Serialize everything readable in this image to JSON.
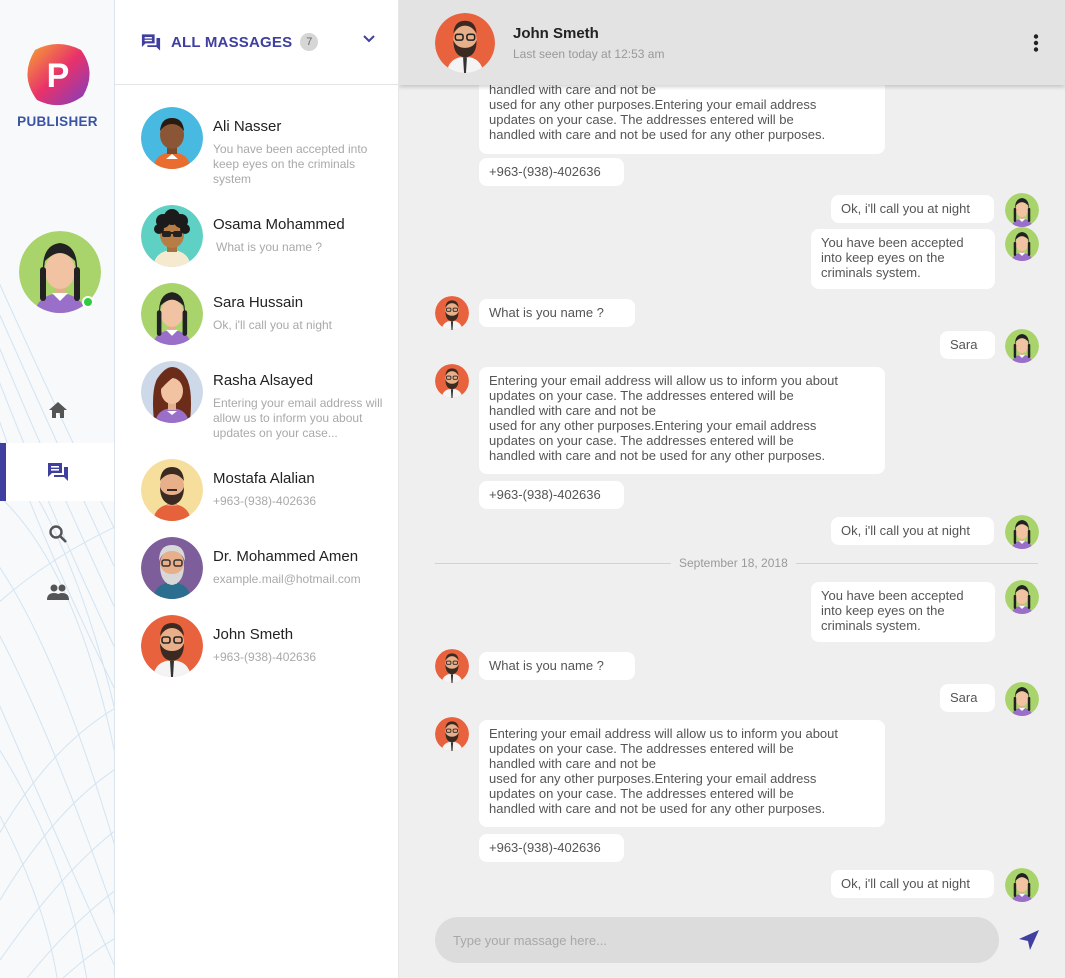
{
  "app": {
    "brand": "PUBLISHER",
    "logo_letter": "P"
  },
  "sidebar": {
    "items": [
      {
        "name": "home",
        "icon": "home-icon"
      },
      {
        "name": "messages",
        "icon": "chat-icon",
        "active": true
      },
      {
        "name": "search",
        "icon": "search-icon"
      },
      {
        "name": "contacts",
        "icon": "people-icon"
      }
    ]
  },
  "contacts_panel": {
    "title": "ALL MASSAGES",
    "count": "7",
    "contacts": [
      {
        "name": "Ali Nasser",
        "preview": "You have been accepted into keep eyes on the criminals system"
      },
      {
        "name": "Osama Mohammed",
        "preview": "What is you name ?"
      },
      {
        "name": "Sara Hussain",
        "preview": "Ok, i'll call you at night"
      },
      {
        "name": "Rasha Alsayed",
        "preview": "Entering your email address will allow us to inform you about updates on your case..."
      },
      {
        "name": "Mostafa Alalian",
        "preview": "+963-(938)-402636"
      },
      {
        "name": "Dr. Mohammed Amen",
        "preview": "example.mail@hotmail.com"
      },
      {
        "name": "John Smeth",
        "preview": "+963-(938)-402636"
      }
    ]
  },
  "chat": {
    "contact_name": "John Smeth",
    "last_seen": "Last seen today at 12:53 am",
    "date_divider": "September 18, 2018",
    "input_placeholder": "Type your massage here...",
    "messages": [
      {
        "from": "them",
        "text": "handled with care and not be\nused for any other purposes.Entering your email address\nupdates on your case. The addresses entered will be\nhandled with care and not be used for any other purposes."
      },
      {
        "from": "them",
        "text": "+963-(938)-402636"
      },
      {
        "from": "me",
        "text": "Ok, i'll call you at night"
      },
      {
        "from": "me",
        "text": "You have been accepted\ninto keep eyes on the\ncriminals system."
      },
      {
        "from": "them",
        "text": "What is you name ?"
      },
      {
        "from": "me",
        "text": "Sara"
      },
      {
        "from": "them",
        "text": "Entering your email address will allow us to inform you about\nupdates on your case. The addresses entered will be\nhandled with care and not be\nused for any other purposes.Entering your email address\nupdates on your case. The addresses entered will be\nhandled with care and not be used for any other purposes."
      },
      {
        "from": "them",
        "text": "+963-(938)-402636"
      },
      {
        "from": "me",
        "text": "Ok, i'll call you at night"
      },
      {
        "from": "me",
        "text": "You have been accepted\ninto keep eyes on the\ncriminals system."
      },
      {
        "from": "them",
        "text": "What is you name ?"
      },
      {
        "from": "me",
        "text": "Sara"
      },
      {
        "from": "them",
        "text": "Entering your email address will allow us to inform you about\nupdates on your case. The addresses entered will be\nhandled with care and not be\nused for any other purposes.Entering your email address\nupdates on your case. The addresses entered will be\nhandled with care and not be used for any other purposes."
      },
      {
        "from": "them",
        "text": "+963-(938)-402636"
      },
      {
        "from": "me",
        "text": "Ok, i'll call you at night"
      }
    ]
  },
  "colors": {
    "accent": "#3e3f9e",
    "brand": "#3a53a4",
    "online": "#2ecc40"
  }
}
